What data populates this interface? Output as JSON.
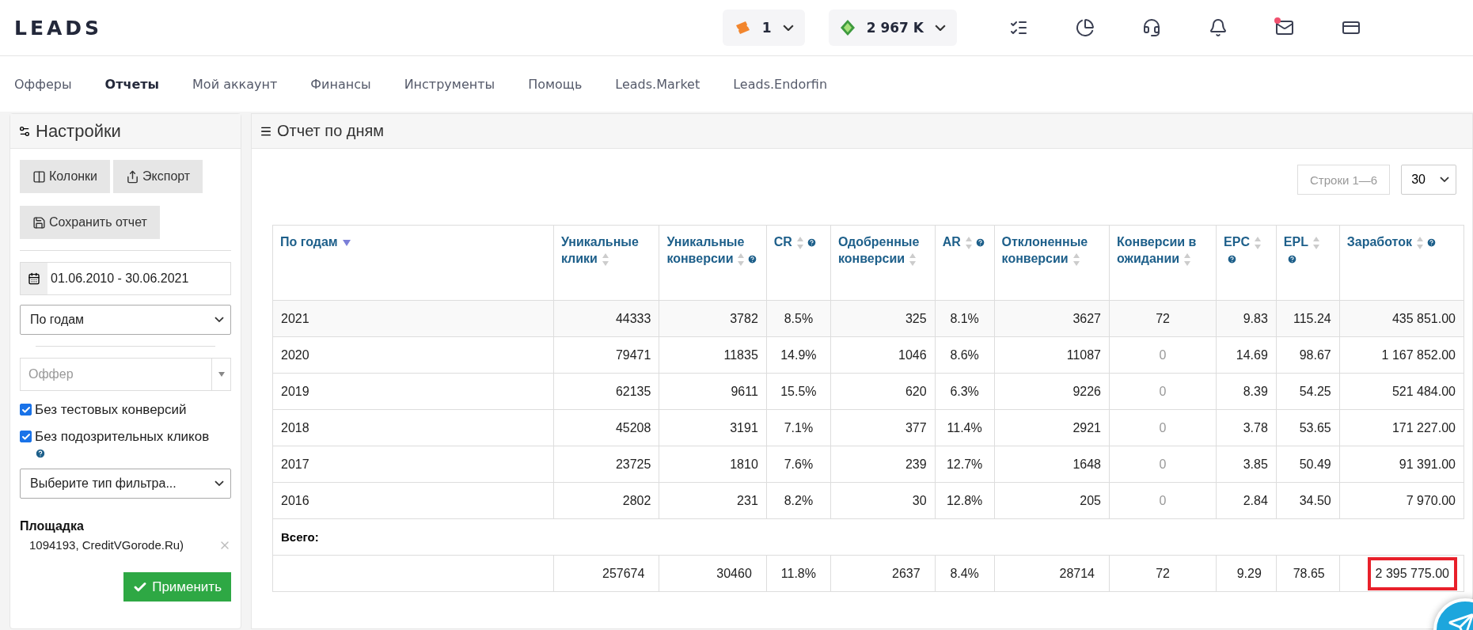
{
  "logo": "LEADS",
  "header": {
    "tickets": "1",
    "balance": "2 967 K",
    "mail_unread": true
  },
  "nav": [
    {
      "label": "Офферы",
      "selected": false
    },
    {
      "label": "Отчеты",
      "selected": true
    },
    {
      "label": "Мой аккаунт",
      "selected": false
    },
    {
      "label": "Финансы",
      "selected": false
    },
    {
      "label": "Инструменты",
      "selected": false
    },
    {
      "label": "Помощь",
      "selected": false
    },
    {
      "label": "Leads.Market",
      "selected": false
    },
    {
      "label": "Leads.Endorfin",
      "selected": false
    }
  ],
  "sidebar": {
    "title": "Настройки",
    "buttons": [
      "Колонки",
      "Экспорт",
      "Сохранить отчет"
    ],
    "date_range": "01.06.2010 - 30.06.2021",
    "grouping": "По годам",
    "offer_placeholder": "Оффер",
    "checkboxes": [
      {
        "label": "Без тестовых конверсий",
        "checked": true,
        "help": false
      },
      {
        "label": "Без подозрительных кликов",
        "checked": true,
        "help": true
      }
    ],
    "filter_type": "Выберите тип фильтра...",
    "platform_label": "Площадка",
    "platform_value": "1094193, CreditVGorode.Ru)",
    "apply": "Применить"
  },
  "report": {
    "title": "Отчет по дням",
    "rows_info": "Строки 1—6",
    "page_size": "30",
    "columns": [
      {
        "label": "По годам",
        "sorted": true,
        "help": false
      },
      {
        "label": "Уникальные клики",
        "sorted": false,
        "help": false
      },
      {
        "label": "Уникальные конверсии",
        "sorted": false,
        "help": true
      },
      {
        "label": "CR",
        "sorted": false,
        "help": true
      },
      {
        "label": "Одобренные конверсии",
        "sorted": false,
        "help": false
      },
      {
        "label": "AR",
        "sorted": false,
        "help": true
      },
      {
        "label": "Отклоненные конверсии",
        "sorted": false,
        "help": false
      },
      {
        "label": "Конверсии в ожидании",
        "sorted": false,
        "help": false
      },
      {
        "label": "EPC",
        "sorted": false,
        "help": true
      },
      {
        "label": "EPL",
        "sorted": false,
        "help": true
      },
      {
        "label": "Заработок",
        "sorted": false,
        "help": true
      }
    ],
    "rows": [
      {
        "cells": [
          "2021",
          "44333",
          "3782",
          "8.5%",
          "325",
          "8.1%",
          "3627",
          "72",
          "9.83",
          "115.24",
          "435 851.00"
        ],
        "pending_muted": false
      },
      {
        "cells": [
          "2020",
          "79471",
          "11835",
          "14.9%",
          "1046",
          "8.6%",
          "11087",
          "0",
          "14.69",
          "98.67",
          "1 167 852.00"
        ],
        "pending_muted": true
      },
      {
        "cells": [
          "2019",
          "62135",
          "9611",
          "15.5%",
          "620",
          "6.3%",
          "9226",
          "0",
          "8.39",
          "54.25",
          "521 484.00"
        ],
        "pending_muted": true
      },
      {
        "cells": [
          "2018",
          "45208",
          "3191",
          "7.1%",
          "377",
          "11.4%",
          "2921",
          "0",
          "3.78",
          "53.65",
          "171 227.00"
        ],
        "pending_muted": true
      },
      {
        "cells": [
          "2017",
          "23725",
          "1810",
          "7.6%",
          "239",
          "12.7%",
          "1648",
          "0",
          "3.85",
          "50.49",
          "91 391.00"
        ],
        "pending_muted": true
      },
      {
        "cells": [
          "2016",
          "2802",
          "231",
          "8.2%",
          "30",
          "12.8%",
          "205",
          "0",
          "2.84",
          "34.50",
          "7 970.00"
        ],
        "pending_muted": true
      }
    ],
    "total_label": "Всего:",
    "totals": [
      {
        "text": "257674",
        "highlighted": false
      },
      {
        "text": "30460",
        "highlighted": false
      },
      {
        "text": "11.8%",
        "highlighted": false
      },
      {
        "text": "2637",
        "highlighted": false
      },
      {
        "text": "8.4%",
        "highlighted": false
      },
      {
        "text": "28714",
        "highlighted": false
      },
      {
        "text": "72",
        "highlighted": false
      },
      {
        "text": "9.29",
        "highlighted": false
      },
      {
        "text": "78.65",
        "highlighted": false
      },
      {
        "text": "2 395 775.00",
        "highlighted": true
      }
    ]
  }
}
